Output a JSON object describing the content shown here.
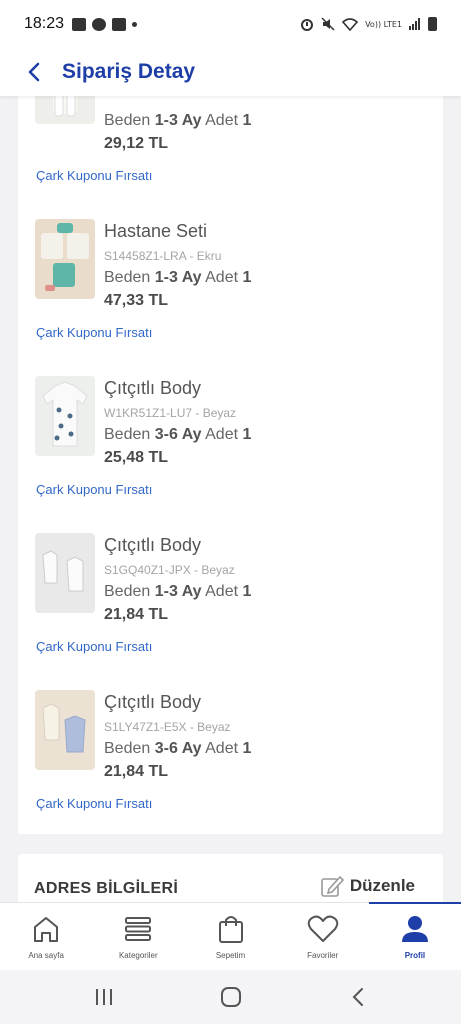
{
  "status_bar": {
    "time": "18:23",
    "network": "Vo)) LTE1"
  },
  "header": {
    "title": "Sipariş Detay"
  },
  "products": [
    {
      "name": "",
      "code": "",
      "size_label": "Beden",
      "size_value": "1-3 Ay",
      "qty_label": "Adet",
      "qty_value": "1",
      "price": "29,12 TL",
      "coupon_link": "Çark Kuponu Fırsatı"
    },
    {
      "name": "Hastane Seti",
      "code": "S14458Z1-LRA - Ekru",
      "size_label": "Beden",
      "size_value": "1-3 Ay",
      "qty_label": "Adet",
      "qty_value": "1",
      "price": "47,33 TL",
      "coupon_link": "Çark Kuponu Fırsatı"
    },
    {
      "name": "Çıtçıtlı Body",
      "code": "W1KR51Z1-LU7 - Beyaz",
      "size_label": "Beden",
      "size_value": "3-6 Ay",
      "qty_label": "Adet",
      "qty_value": "1",
      "price": "25,48 TL",
      "coupon_link": "Çark Kuponu Fırsatı"
    },
    {
      "name": "Çıtçıtlı Body",
      "code": "S1GQ40Z1-JPX - Beyaz",
      "size_label": "Beden",
      "size_value": "1-3 Ay",
      "qty_label": "Adet",
      "qty_value": "1",
      "price": "21,84 TL",
      "coupon_link": "Çark Kuponu Fırsatı"
    },
    {
      "name": "Çıtçıtlı Body",
      "code": "S1LY47Z1-E5X - Beyaz",
      "size_label": "Beden",
      "size_value": "3-6 Ay",
      "qty_label": "Adet",
      "qty_value": "1",
      "price": "21,84 TL",
      "coupon_link": "Çark Kuponu Fırsatı"
    }
  ],
  "address": {
    "title": "ADRES BİLGİLERİ",
    "edit_label": "Düzenle"
  },
  "bottom_nav": {
    "items": [
      {
        "label": "Ana sayfa",
        "icon": "home-icon"
      },
      {
        "label": "Kategoriler",
        "icon": "categories-icon"
      },
      {
        "label": "Sepetim",
        "icon": "shopping-bag-icon"
      },
      {
        "label": "Favoriler",
        "icon": "heart-icon"
      },
      {
        "label": "Profil",
        "icon": "profile-icon"
      }
    ],
    "active": "Profil"
  },
  "colors": {
    "brand_blue": "#1f3fa8",
    "link_blue": "#3267c9",
    "background": "#f2f2f4"
  }
}
